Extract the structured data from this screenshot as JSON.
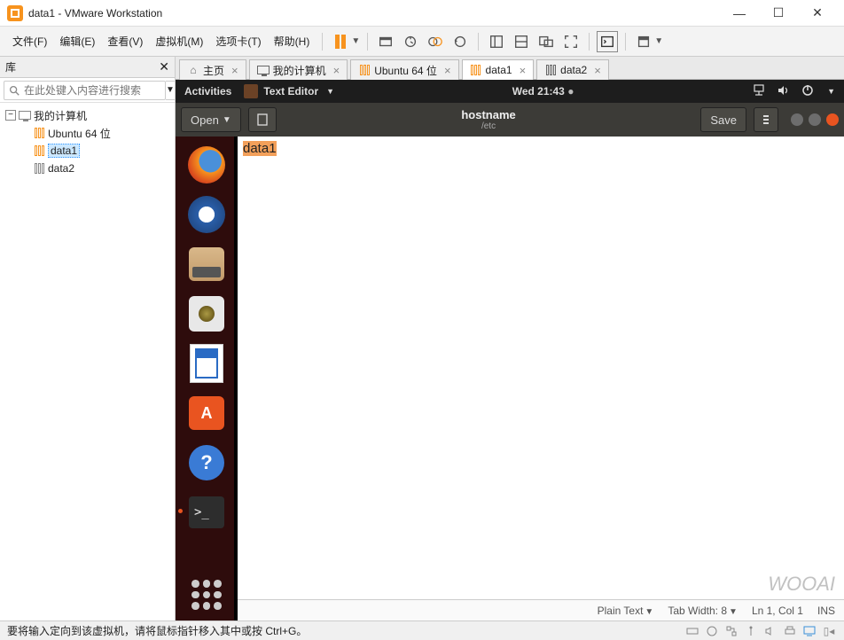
{
  "window": {
    "title": "data1 - VMware Workstation",
    "controls": {
      "min": "—",
      "max": "☐",
      "close": "✕"
    }
  },
  "menu": {
    "items": [
      "文件(F)",
      "编辑(E)",
      "查看(V)",
      "虚拟机(M)",
      "选项卡(T)",
      "帮助(H)"
    ]
  },
  "library": {
    "header": "库",
    "close": "✕",
    "search_placeholder": "在此处键入内容进行搜索",
    "root": {
      "label": "我的计算机"
    },
    "items": [
      {
        "label": "Ubuntu 64 位",
        "selected": false
      },
      {
        "label": "data1",
        "selected": true
      },
      {
        "label": "data2",
        "selected": false
      }
    ]
  },
  "vm_tabs": [
    {
      "label": "主页",
      "icon": "home",
      "active": false
    },
    {
      "label": "我的计算机",
      "icon": "monitor",
      "active": false
    },
    {
      "label": "Ubuntu 64 位",
      "icon": "tabs-orange",
      "active": false
    },
    {
      "label": "data1",
      "icon": "tabs-orange",
      "active": true
    },
    {
      "label": "data2",
      "icon": "tabs-grey",
      "active": false
    }
  ],
  "gnome": {
    "activities": "Activities",
    "app_name": "Text Editor",
    "clock": "Wed 21:43"
  },
  "gedit": {
    "open": "Open",
    "save": "Save",
    "title": "hostname",
    "subtitle": "/etc",
    "content": "data1",
    "status": {
      "syntax": "Plain Text",
      "tab": "Tab Width: 8",
      "cursor": "Ln 1, Col 1",
      "ins": "INS"
    }
  },
  "dock": {
    "items": [
      {
        "name": "firefox-icon"
      },
      {
        "name": "thunderbird-icon"
      },
      {
        "name": "files-icon"
      },
      {
        "name": "rhythmbox-icon"
      },
      {
        "name": "libreoffice-writer-icon"
      },
      {
        "name": "ubuntu-software-icon",
        "glyph": "A"
      },
      {
        "name": "help-icon",
        "glyph": "?"
      },
      {
        "name": "terminal-icon",
        "glyph": ">_"
      }
    ]
  },
  "statusbar": {
    "hint": "要将输入定向到该虚拟机，请将鼠标指针移入其中或按 Ctrl+G。"
  },
  "watermark": "WOOAI"
}
